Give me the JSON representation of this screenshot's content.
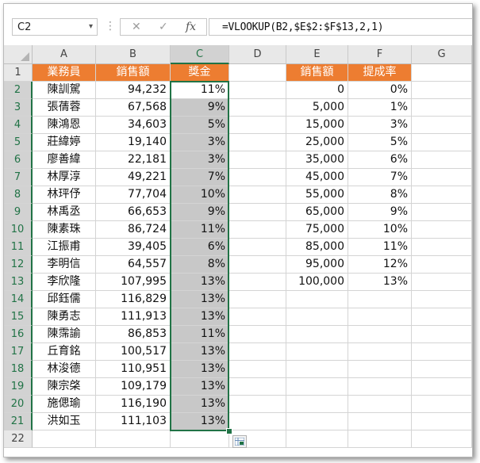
{
  "name_box": {
    "value": "C2",
    "arrow": "▾"
  },
  "formula_bar": {
    "divider": "⋮",
    "cancel": "✕",
    "enter": "✓",
    "fx": "fx",
    "formula": "=VLOOKUP(B2,$E$2:$F$13,2,1)"
  },
  "columns": [
    "A",
    "B",
    "C",
    "D",
    "E",
    "F",
    "G"
  ],
  "selected_column": "C",
  "rows": [
    "1",
    "2",
    "3",
    "4",
    "5",
    "6",
    "7",
    "8",
    "9",
    "10",
    "11",
    "12",
    "13",
    "14",
    "15",
    "16",
    "17",
    "18",
    "19",
    "20",
    "21",
    "22"
  ],
  "headers": {
    "a": "業務員",
    "b": "銷售額",
    "c": "獎金",
    "e": "銷售額",
    "f": "提成率"
  },
  "records": [
    {
      "name": "陳訓駕",
      "sales": "94,232",
      "bonus": "11%"
    },
    {
      "name": "張蒨蓉",
      "sales": "67,568",
      "bonus": "9%"
    },
    {
      "name": "陳鴻恩",
      "sales": "34,603",
      "bonus": "5%"
    },
    {
      "name": "莊緯婷",
      "sales": "19,140",
      "bonus": "3%"
    },
    {
      "name": "廖善緯",
      "sales": "22,181",
      "bonus": "3%"
    },
    {
      "name": "林厚淳",
      "sales": "49,221",
      "bonus": "7%"
    },
    {
      "name": "林玶伃",
      "sales": "77,704",
      "bonus": "10%"
    },
    {
      "name": "林禹丞",
      "sales": "66,653",
      "bonus": "9%"
    },
    {
      "name": "陳素珠",
      "sales": "86,724",
      "bonus": "11%"
    },
    {
      "name": "江振甫",
      "sales": "39,405",
      "bonus": "6%"
    },
    {
      "name": "李明信",
      "sales": "64,557",
      "bonus": "8%"
    },
    {
      "name": "李欣隆",
      "sales": "107,995",
      "bonus": "13%"
    },
    {
      "name": "邱鈺儒",
      "sales": "116,829",
      "bonus": "13%"
    },
    {
      "name": "陳勇志",
      "sales": "111,913",
      "bonus": "13%"
    },
    {
      "name": "陳霈諭",
      "sales": "86,853",
      "bonus": "11%"
    },
    {
      "name": "丘育銘",
      "sales": "100,517",
      "bonus": "13%"
    },
    {
      "name": "林浚德",
      "sales": "110,951",
      "bonus": "13%"
    },
    {
      "name": "陳宗棨",
      "sales": "109,179",
      "bonus": "13%"
    },
    {
      "name": "施偲瑜",
      "sales": "116,190",
      "bonus": "13%"
    },
    {
      "name": "洪如玉",
      "sales": "111,103",
      "bonus": "13%"
    }
  ],
  "lookup": [
    {
      "threshold": "0",
      "rate": "0%"
    },
    {
      "threshold": "5,000",
      "rate": "1%"
    },
    {
      "threshold": "15,000",
      "rate": "3%"
    },
    {
      "threshold": "25,000",
      "rate": "5%"
    },
    {
      "threshold": "35,000",
      "rate": "6%"
    },
    {
      "threshold": "45,000",
      "rate": "7%"
    },
    {
      "threshold": "55,000",
      "rate": "8%"
    },
    {
      "threshold": "65,000",
      "rate": "9%"
    },
    {
      "threshold": "75,000",
      "rate": "10%"
    },
    {
      "threshold": "85,000",
      "rate": "11%"
    },
    {
      "threshold": "95,000",
      "rate": "12%"
    },
    {
      "threshold": "100,000",
      "rate": "13%"
    }
  ],
  "colors": {
    "header_fill": "#ed7d31",
    "selection": "#217346",
    "selected_range_fill": "#c8c8c8"
  }
}
